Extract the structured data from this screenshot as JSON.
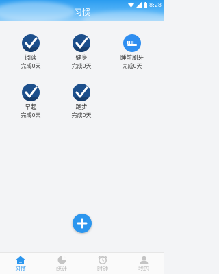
{
  "status_bar": {
    "time": "8:28"
  },
  "header": {
    "title": "习惯"
  },
  "habits": [
    {
      "name": "阅读",
      "done": "完成0天",
      "icon": "checkmark-badge-icon"
    },
    {
      "name": "健身",
      "done": "完成0天",
      "icon": "checkmark-badge-icon"
    },
    {
      "name": "睡前刷牙",
      "done": "完成0天",
      "icon": "toothbrush-icon"
    },
    {
      "name": "早起",
      "done": "完成0天",
      "icon": "checkmark-badge-icon"
    },
    {
      "name": "跑步",
      "done": "完成0天",
      "icon": "checkmark-badge-icon"
    }
  ],
  "fab": {
    "icon": "plus-icon"
  },
  "tabs": [
    {
      "label": "习惯",
      "icon": "home-icon",
      "active": true
    },
    {
      "label": "统计",
      "icon": "pie-chart-icon",
      "active": false
    },
    {
      "label": "时钟",
      "icon": "alarm-clock-icon",
      "active": false
    },
    {
      "label": "我的",
      "icon": "user-icon",
      "active": false
    }
  ],
  "colors": {
    "accent": "#2c96ee",
    "habit_icon": "#1c4f8c",
    "inactive_tab": "#b5b5b5"
  }
}
